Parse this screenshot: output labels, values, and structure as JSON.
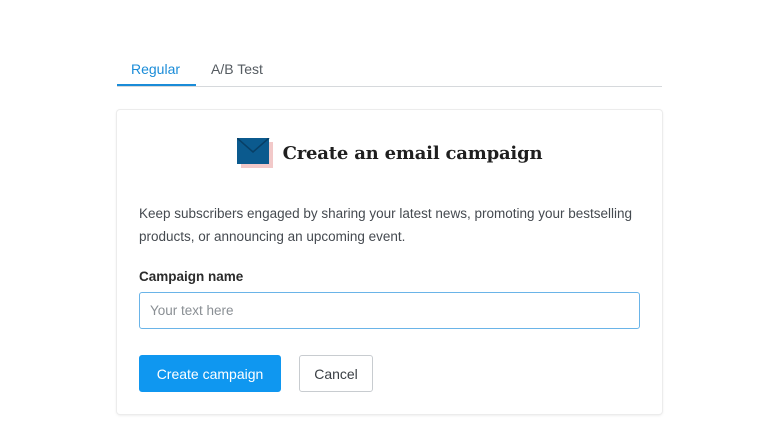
{
  "tabs": {
    "regular": "Regular",
    "ab_test": "A/B Test"
  },
  "card": {
    "icon": "envelope-icon",
    "title": "Create an email campaign",
    "description": "Keep subscribers engaged by sharing your latest news, promoting your bestselling products, or announcing an upcoming event.",
    "field_label": "Campaign name",
    "input_value": "",
    "input_placeholder": "Your text here",
    "create_label": "Create campaign",
    "cancel_label": "Cancel"
  },
  "colors": {
    "accent": "#1a8cd8",
    "primary_button": "#0f97f0",
    "envelope": "#0b5a8e",
    "envelope_shadow": "#f2c9c9"
  }
}
